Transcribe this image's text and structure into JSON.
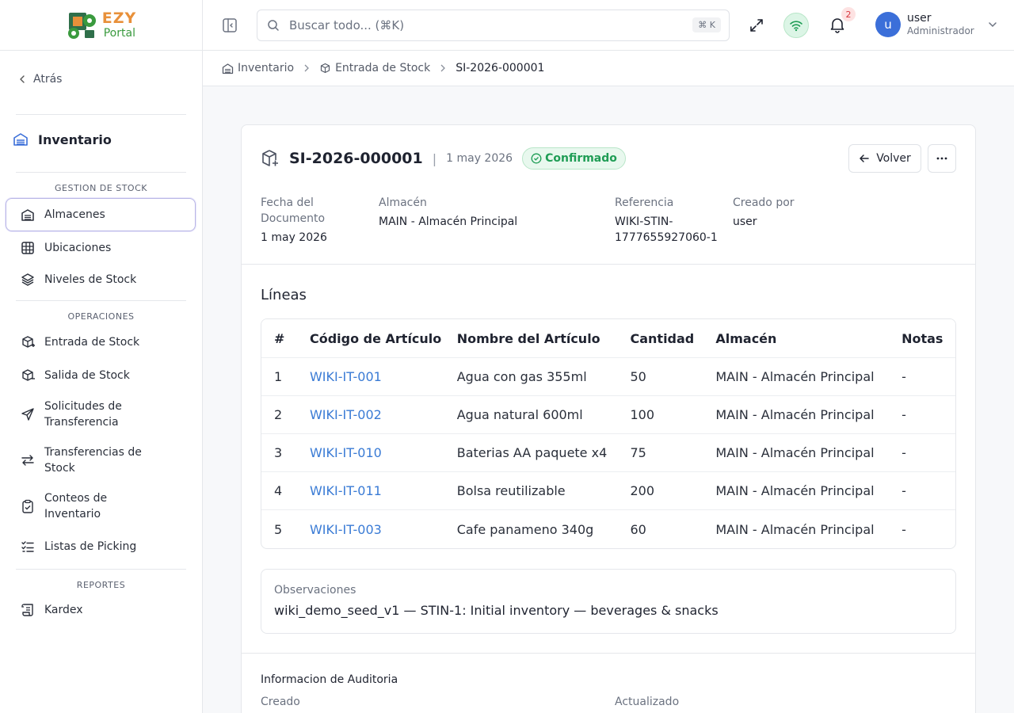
{
  "brand": {
    "name_top": "EZY",
    "name_bottom": "Portal"
  },
  "sidebar": {
    "back_label": "Atrás",
    "module_title": "Inventario",
    "sections": [
      {
        "label": "GESTION DE STOCK"
      },
      {
        "label": "OPERACIONES"
      },
      {
        "label": "REPORTES"
      }
    ],
    "items": [
      {
        "label": "Almacenes",
        "icon": "warehouse-icon"
      },
      {
        "label": "Ubicaciones",
        "icon": "grid-icon"
      },
      {
        "label": "Niveles de Stock",
        "icon": "layers-icon"
      },
      {
        "label": "Entrada de Stock",
        "icon": "package-plus-icon"
      },
      {
        "label": "Salida de Stock",
        "icon": "package-minus-icon"
      },
      {
        "label_line1": "Solicitudes de",
        "label_line2": "Transferencia",
        "icon": "send-icon"
      },
      {
        "label_line1": "Transferencias de",
        "label_line2": "Stock",
        "icon": "arrows-swap-icon"
      },
      {
        "label_line1": "Conteos de",
        "label_line2": "Inventario",
        "icon": "clipboard-check-icon"
      },
      {
        "label": "Listas de Picking",
        "icon": "list-checks-icon"
      },
      {
        "label": "Kardex",
        "icon": "scroll-icon"
      }
    ]
  },
  "topbar": {
    "search_placeholder": "Buscar todo... (⌘K)",
    "search_shortcut": "⌘ K",
    "notifications_count": "2",
    "user": {
      "initial": "u",
      "name": "user",
      "role": "Administrador"
    }
  },
  "breadcrumb": {
    "items": [
      "Inventario",
      "Entrada de Stock",
      "SI-2026-000001"
    ]
  },
  "document": {
    "number": "SI-2026-000001",
    "date": "1 may 2026",
    "status": "Confirmado",
    "back_button": "Volver",
    "meta": {
      "fecha_label_1": "Fecha del",
      "fecha_label_2": "Documento",
      "fecha_value": "1 may 2026",
      "almacen_label": "Almacén",
      "almacen_value": "MAIN - Almacén Principal",
      "referencia_label": "Referencia",
      "referencia_value_1": "WIKI-STIN-",
      "referencia_value_2": "1777655927060-1",
      "creado_label": "Creado por",
      "creado_value": "user"
    },
    "lines_title": "Líneas",
    "table": {
      "headers": [
        "#",
        "Código de Artículo",
        "Nombre del Artículo",
        "Cantidad",
        "Almacén",
        "Notas"
      ],
      "rows": [
        [
          "1",
          "WIKI-IT-001",
          "Agua con gas 355ml",
          "50",
          "MAIN - Almacén Principal",
          "-"
        ],
        [
          "2",
          "WIKI-IT-002",
          "Agua natural 600ml",
          "100",
          "MAIN - Almacén Principal",
          "-"
        ],
        [
          "3",
          "WIKI-IT-010",
          "Baterias AA paquete x4",
          "75",
          "MAIN - Almacén Principal",
          "-"
        ],
        [
          "4",
          "WIKI-IT-011",
          "Bolsa reutilizable",
          "200",
          "MAIN - Almacén Principal",
          "-"
        ],
        [
          "5",
          "WIKI-IT-003",
          "Cafe panameno 340g",
          "60",
          "MAIN - Almacén Principal",
          "-"
        ]
      ]
    },
    "observations": {
      "label": "Observaciones",
      "value": "wiki_demo_seed_v1 — STIN-1: Initial inventory — beverages & snacks"
    },
    "audit": {
      "title": "Informacion de Auditoria",
      "created_label": "Creado",
      "updated_label": "Actualizado"
    }
  },
  "colors": {
    "accent": "#3b6fd9",
    "link": "#3a7bd5",
    "success": "#1f9d55",
    "brand_orange": "#e8903a",
    "brand_green": "#3a9a3e"
  }
}
